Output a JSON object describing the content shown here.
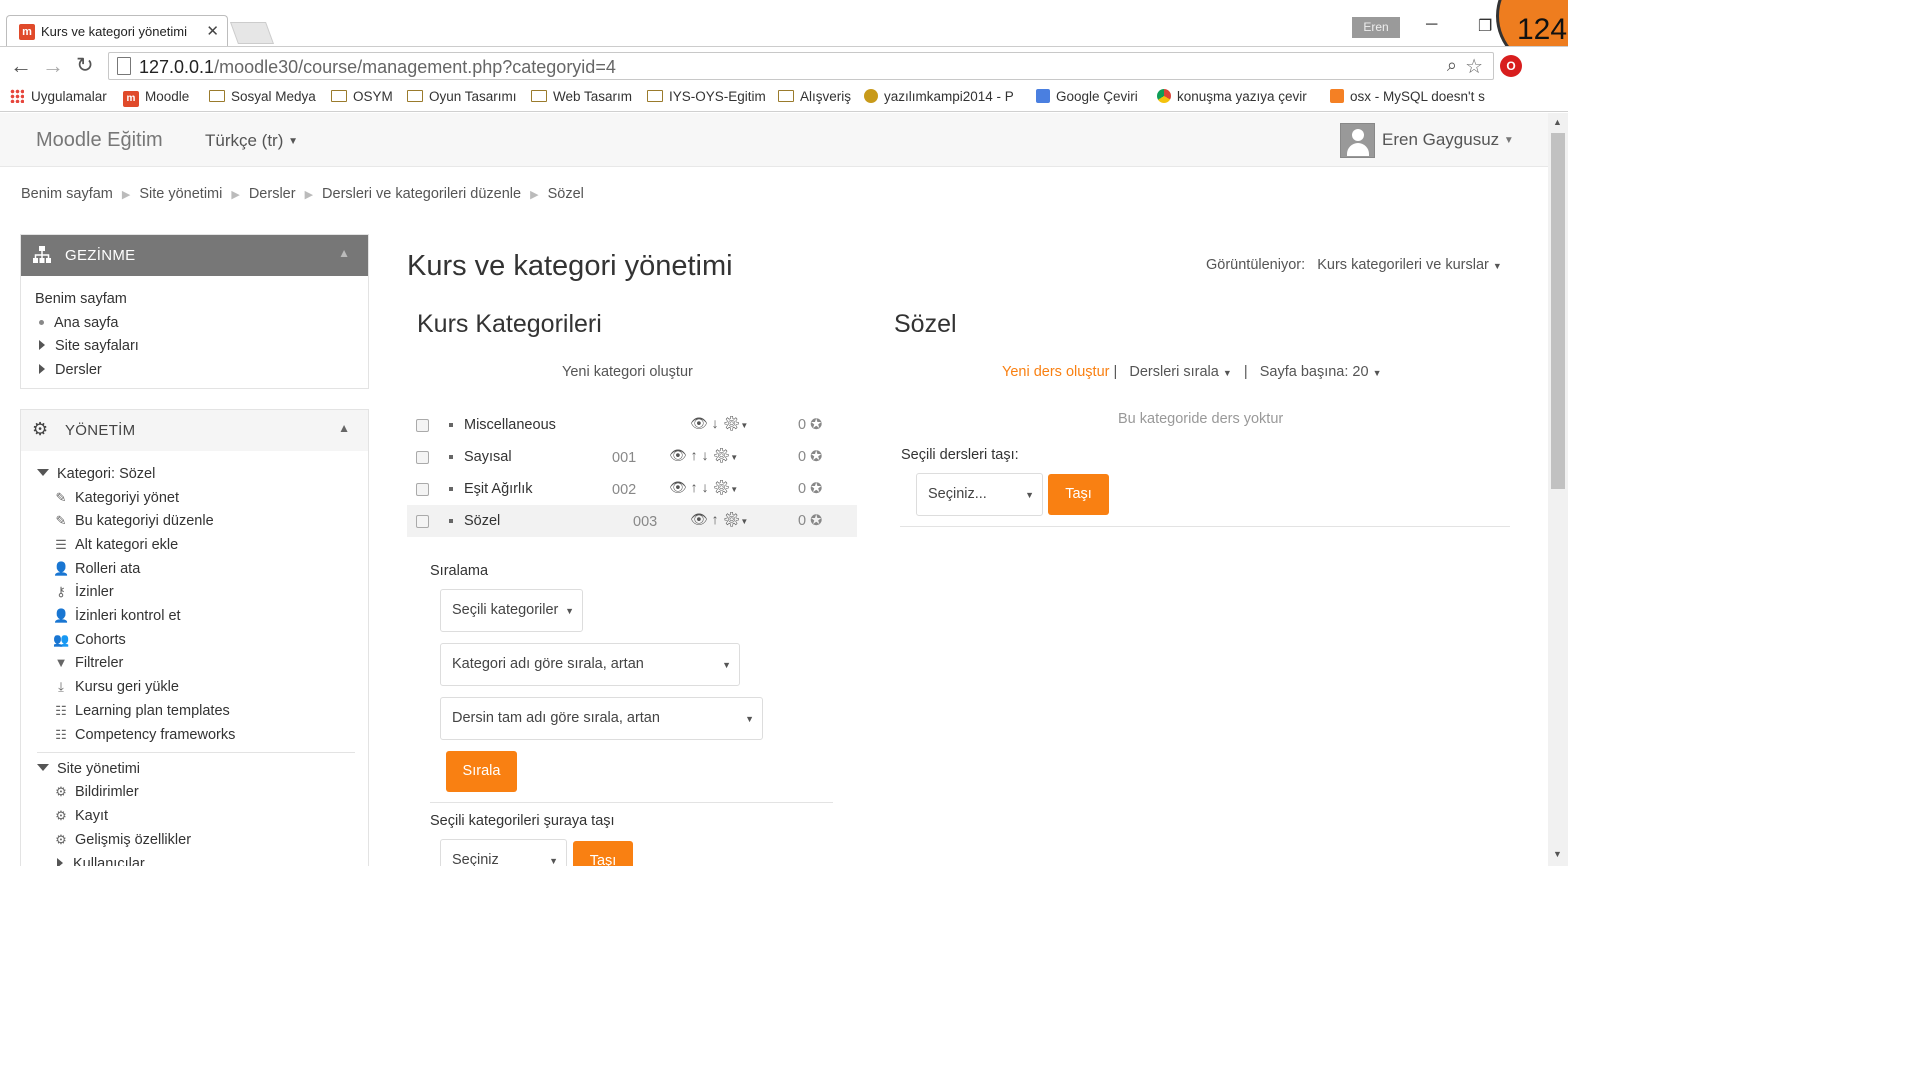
{
  "browser": {
    "tab_title": "Kurs ve kategori yönetimi",
    "tab_favicon": "m",
    "window_user": "Eren",
    "counter": "124",
    "url_host": "127.0.0.1",
    "url_path": "/moodle30/course/management.php?categoryid=4",
    "extension_icon": "O"
  },
  "bookmarks": [
    {
      "label": "Uygulamalar",
      "icon": "apps-icon"
    },
    {
      "label": "Moodle",
      "icon": "moodle-icon"
    },
    {
      "label": "Sosyal Medya",
      "icon": "folder-icon"
    },
    {
      "label": "OSYM",
      "icon": "folder-icon"
    },
    {
      "label": "Oyun Tasarımı",
      "icon": "folder-icon"
    },
    {
      "label": "Web Tasarım",
      "icon": "folder-icon"
    },
    {
      "label": "IYS-OYS-Egitim",
      "icon": "folder-icon"
    },
    {
      "label": "Alışveriş",
      "icon": "folder-icon"
    },
    {
      "label": "yazılımkampi2014 - P",
      "icon": "site-icon"
    },
    {
      "label": "Google Çeviri",
      "icon": "translate-icon"
    },
    {
      "label": "konuşma yazıya çevir",
      "icon": "chrome-icon"
    },
    {
      "label": "osx - MySQL doesn't s",
      "icon": "stack-icon"
    }
  ],
  "navbar": {
    "brand": "Moodle Eğitim",
    "language": "Türkçe (tr)",
    "user_name": "Eren Gaygusuz"
  },
  "breadcrumb": [
    "Benim sayfam",
    "Site yönetimi",
    "Dersler",
    "Dersleri ve kategorileri düzenle",
    "Sözel"
  ],
  "navigation_block": {
    "title": "GEZİNME",
    "items": [
      {
        "label": "Benim sayfam"
      },
      {
        "label": "Ana sayfa"
      },
      {
        "label": "Site sayfaları"
      },
      {
        "label": "Dersler"
      }
    ]
  },
  "admin_block": {
    "title": "YÖNETİM",
    "category_header": "Kategori: Sözel",
    "category_items": [
      {
        "label": "Kategoriyi yönet",
        "icon": "pencil-icon"
      },
      {
        "label": "Bu kategoriyi düzenle",
        "icon": "pencil-icon"
      },
      {
        "label": "Alt kategori ekle",
        "icon": "subcategory-icon"
      },
      {
        "label": "Rolleri ata",
        "icon": "user-icon"
      },
      {
        "label": "İzinler",
        "icon": "key-icon"
      },
      {
        "label": "İzinleri kontrol et",
        "icon": "user-check-icon"
      },
      {
        "label": "Cohorts",
        "icon": "users-icon"
      },
      {
        "label": "Filtreler",
        "icon": "filter-icon"
      },
      {
        "label": "Kursu geri yükle",
        "icon": "restore-icon"
      },
      {
        "label": "Learning plan templates",
        "icon": "template-icon"
      },
      {
        "label": "Competency frameworks",
        "icon": "template-icon"
      }
    ],
    "site_header": "Site yönetimi",
    "site_items": [
      {
        "label": "Bildirimler",
        "icon": "gear-icon"
      },
      {
        "label": "Kayıt",
        "icon": "gear-icon"
      },
      {
        "label": "Gelişmiş özellikler",
        "icon": "gear-icon"
      },
      {
        "label": "Kullanıcılar",
        "icon": "triangle-right-icon"
      }
    ]
  },
  "main": {
    "title": "Kurs ve kategori yönetimi",
    "viewing_label": "Görüntüleniyor:",
    "viewing_value": "Kurs kategorileri ve kurslar",
    "categories_heading": "Kurs Kategorileri",
    "new_category": "Yeni kategori oluştur",
    "categories": [
      {
        "name": "Miscellaneous",
        "idnumber": "",
        "count": "0",
        "active": false
      },
      {
        "name": "Sayısal",
        "idnumber": "001",
        "count": "0",
        "active": false
      },
      {
        "name": "Eşit Ağırlık",
        "idnumber": "002",
        "count": "0",
        "active": false
      },
      {
        "name": "Sözel",
        "idnumber": "003",
        "count": "0",
        "active": true
      }
    ],
    "sort_label": "Sıralama",
    "sort_scope": "Seçili kategoriler",
    "sort_categories": "Kategori adı göre sırala, artan",
    "sort_courses": "Dersin tam adı göre sırala, artan",
    "sort_button": "Sırala",
    "move_categories_label": "Seçili kategorileri şuraya taşı",
    "move_categories_select": "Seçiniz",
    "move_categories_button": "Taşı"
  },
  "sozel": {
    "heading": "Sözel",
    "new_course": "Yeni ders oluştur",
    "sort_courses": "Dersleri sırala",
    "per_page": "Sayfa başına: 20",
    "empty_text": "Bu kategoride ders yoktur",
    "move_label": "Seçili dersleri taşı:",
    "move_select": "Seçiniz...",
    "move_button": "Taşı"
  },
  "colors": {
    "accent": "#f98012",
    "block_header": "#777777",
    "counter_badge": "#ee7d1f"
  }
}
